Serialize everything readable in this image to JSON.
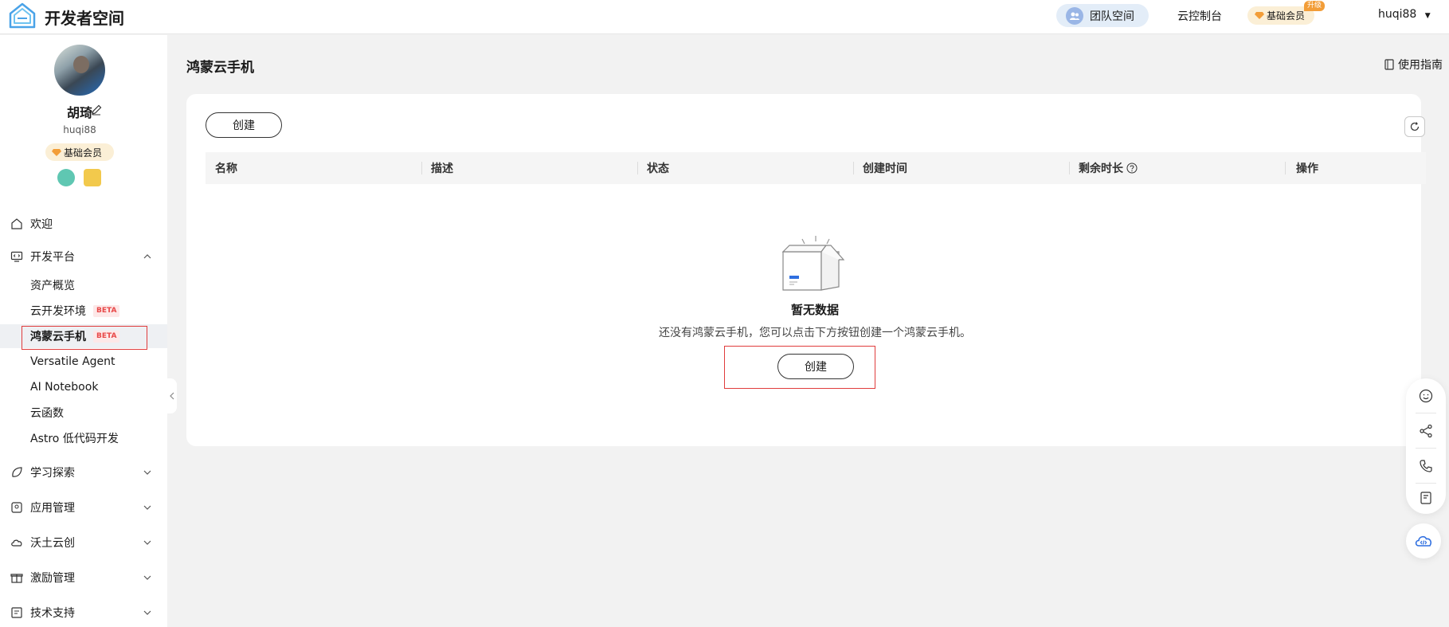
{
  "header": {
    "brand": "开发者空间",
    "team_space": "团队空间",
    "console": "云控制台",
    "membership": "基础会员",
    "upgrade": "升级",
    "user": "huqi88"
  },
  "profile": {
    "name": "胡琦",
    "handle": "huqi88",
    "membership": "基础会员"
  },
  "sidebar": {
    "welcome": "欢迎",
    "dev_platform": "开发平台",
    "sub_items": [
      {
        "label": "资产概览",
        "beta": ""
      },
      {
        "label": "云开发环境",
        "beta": "BETA"
      },
      {
        "label": "鸿蒙云手机",
        "beta": "BETA"
      },
      {
        "label": "Versatile Agent",
        "beta": ""
      },
      {
        "label": "AI Notebook",
        "beta": ""
      },
      {
        "label": "云函数",
        "beta": ""
      },
      {
        "label": "Astro 低代码开发",
        "beta": ""
      }
    ],
    "groups": [
      "学习探索",
      "应用管理",
      "沃土云创",
      "激励管理",
      "技术支持"
    ]
  },
  "main": {
    "title": "鸿蒙云手机",
    "guide": "使用指南",
    "create": "创建",
    "columns": [
      "名称",
      "描述",
      "状态",
      "创建时间",
      "剩余时长",
      "操作"
    ],
    "empty_title": "暂无数据",
    "empty_desc": "还没有鸿蒙云手机，您可以点击下方按钮创建一个鸿蒙云手机。",
    "empty_create": "创建"
  },
  "colors": {
    "accent": "#2f6fe0",
    "highlight_border": "#e03c3c",
    "member_bg": "#fbefd6",
    "upgrade": "#f29d38"
  }
}
